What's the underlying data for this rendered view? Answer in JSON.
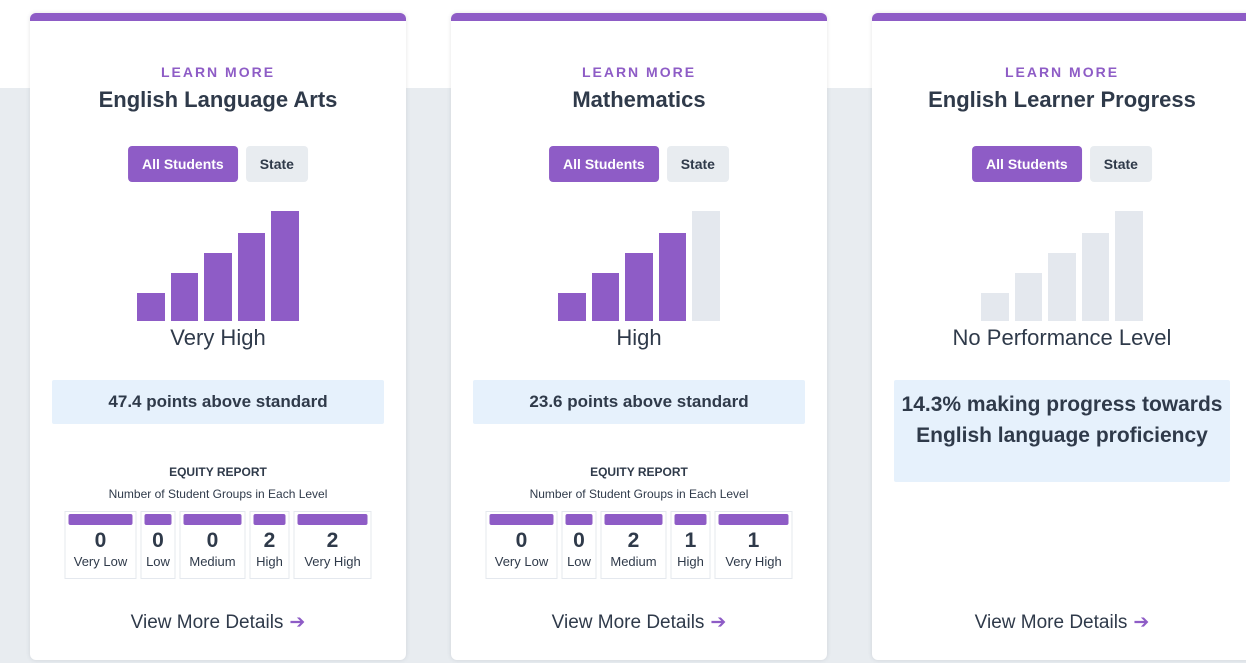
{
  "cards": [
    {
      "learn_more": "LEARN MORE",
      "title": "English Language Arts",
      "toggle": {
        "all_students": "All Students",
        "state": "State"
      },
      "level": {
        "label": "Very High",
        "filled_bars": 5,
        "total_bars": 5
      },
      "metric": "47.4 points above standard",
      "equity": {
        "title": "EQUITY REPORT",
        "subtitle": "Number of Student Groups in Each Level",
        "groups": [
          {
            "label": "Very Low",
            "value": "0"
          },
          {
            "label": "Low",
            "value": "0"
          },
          {
            "label": "Medium",
            "value": "0"
          },
          {
            "label": "High",
            "value": "2"
          },
          {
            "label": "Very High",
            "value": "2"
          }
        ]
      },
      "details_link": "View More Details"
    },
    {
      "learn_more": "LEARN MORE",
      "title": "Mathematics",
      "toggle": {
        "all_students": "All Students",
        "state": "State"
      },
      "level": {
        "label": "High",
        "filled_bars": 4,
        "total_bars": 5
      },
      "metric": "23.6 points above standard",
      "equity": {
        "title": "EQUITY REPORT",
        "subtitle": "Number of Student Groups in Each Level",
        "groups": [
          {
            "label": "Very Low",
            "value": "0"
          },
          {
            "label": "Low",
            "value": "0"
          },
          {
            "label": "Medium",
            "value": "2"
          },
          {
            "label": "High",
            "value": "1"
          },
          {
            "label": "Very High",
            "value": "1"
          }
        ]
      },
      "details_link": "View More Details"
    },
    {
      "learn_more": "LEARN MORE",
      "title": "English Learner Progress",
      "toggle": {
        "all_students": "All Students",
        "state": "State"
      },
      "level": {
        "label": "No Performance Level",
        "filled_bars": 0,
        "total_bars": 5
      },
      "metric": "14.3% making progress towards English language proficiency",
      "details_link": "View More Details"
    }
  ],
  "icons": {
    "details_arrow": "arrow-right-icon"
  },
  "colors": {
    "accent": "#8e5cc6",
    "text": "#2f3a4a",
    "metric_bg": "#e6f1fc",
    "bar_empty": "#e4e8ee",
    "page_band": "#e8ecf0"
  }
}
